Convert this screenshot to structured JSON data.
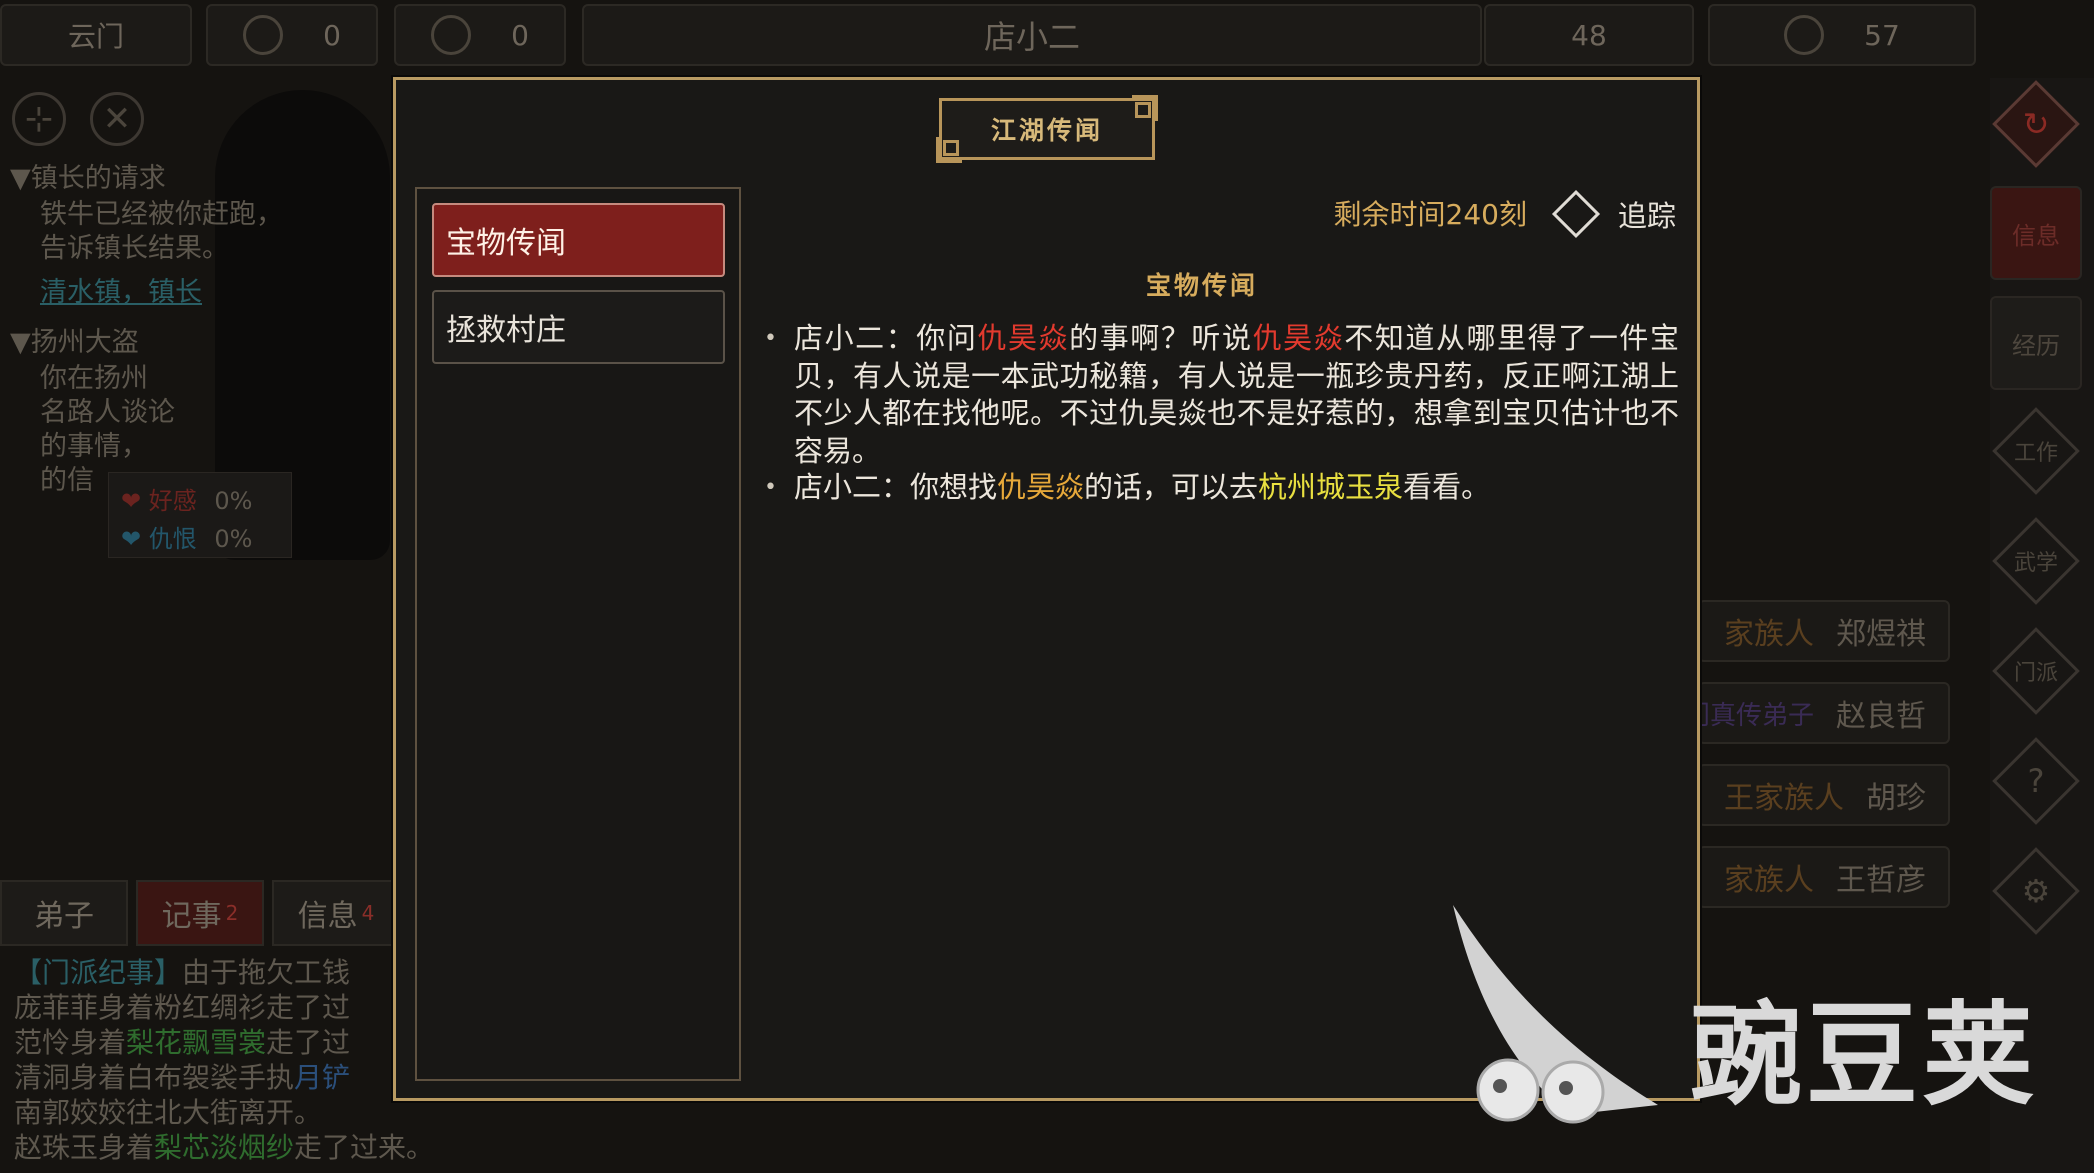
{
  "hud": {
    "sect_name": "云门",
    "resource1_value": "0",
    "resource2_value": "0",
    "npc_name": "店小二",
    "stat1_value": "48",
    "stat2_value": "57"
  },
  "quests": [
    {
      "title": "▼镇长的请求",
      "lines": [
        "铁牛已经被你赶跑，",
        "告诉镇长结果。"
      ],
      "link": "清水镇，镇长"
    },
    {
      "title": "▼扬州大盗",
      "lines": [
        "你在扬州",
        "名路人谈论",
        "的事情，",
        "的信"
      ]
    }
  ],
  "affinity": {
    "favor_label": "好感",
    "favor_value": "0%",
    "hatred_label": "仇恨",
    "hatred_value": "0%"
  },
  "bottom_tabs": [
    {
      "label": "弟子",
      "badge": ""
    },
    {
      "label": "记事",
      "badge": "2"
    },
    {
      "label": "信息",
      "badge": "4"
    }
  ],
  "log": {
    "line1_tag": "【门派纪事】",
    "line1_text": "由于拖欠工钱",
    "line2": "庞菲菲身着粉红绸衫走了过",
    "line3_a": "范怜身着",
    "line3_item": "梨花飘雪裳",
    "line3_b": "走了过",
    "line4_a": "清洞身着白布袈裟手执",
    "line4_item": "月铲",
    "line5": "南郭姣姣往北大街离开。",
    "line6_a": "赵珠玉身着",
    "line6_item": "梨芯淡烟纱",
    "line6_b": "走了过来。"
  },
  "side_menu": {
    "info": "信息",
    "history": "经历",
    "work": "工作",
    "martial": "武学",
    "sect": "门派",
    "help": "?",
    "settings": "⚙"
  },
  "members": [
    {
      "role": "家族人",
      "name": "郑煜祺",
      "purple": false
    },
    {
      "role": "门真传弟子",
      "name": "赵良哲",
      "purple": true
    },
    {
      "role": "王家族人",
      "name": "胡珍",
      "purple": false
    },
    {
      "role": "家族人",
      "name": "王哲彦",
      "purple": false
    }
  ],
  "modal": {
    "title": "江湖传闻",
    "list": [
      "宝物传闻",
      "拯救村庄"
    ],
    "timer": "剩余时间240刻",
    "track": "追踪",
    "content_title": "宝物传闻",
    "entry1": {
      "a": "店小二：你问",
      "n1": "仇昊焱",
      "b": "的事啊？听说",
      "n2": "仇昊焱",
      "c": "不知道从哪里得了一件宝贝，有人说是一本武功秘籍，有人说是一瓶珍贵丹药，反正啊江湖上不少人都在找他呢。不过仇昊焱也不是好惹的，想拿到宝贝估计也不容易。"
    },
    "entry2": {
      "a": "店小二：你想找",
      "n1": "仇昊焱",
      "b": "的话，可以去",
      "place": "杭州城玉泉",
      "c": "看看。"
    }
  },
  "watermark": {
    "text": "豌豆荚"
  }
}
